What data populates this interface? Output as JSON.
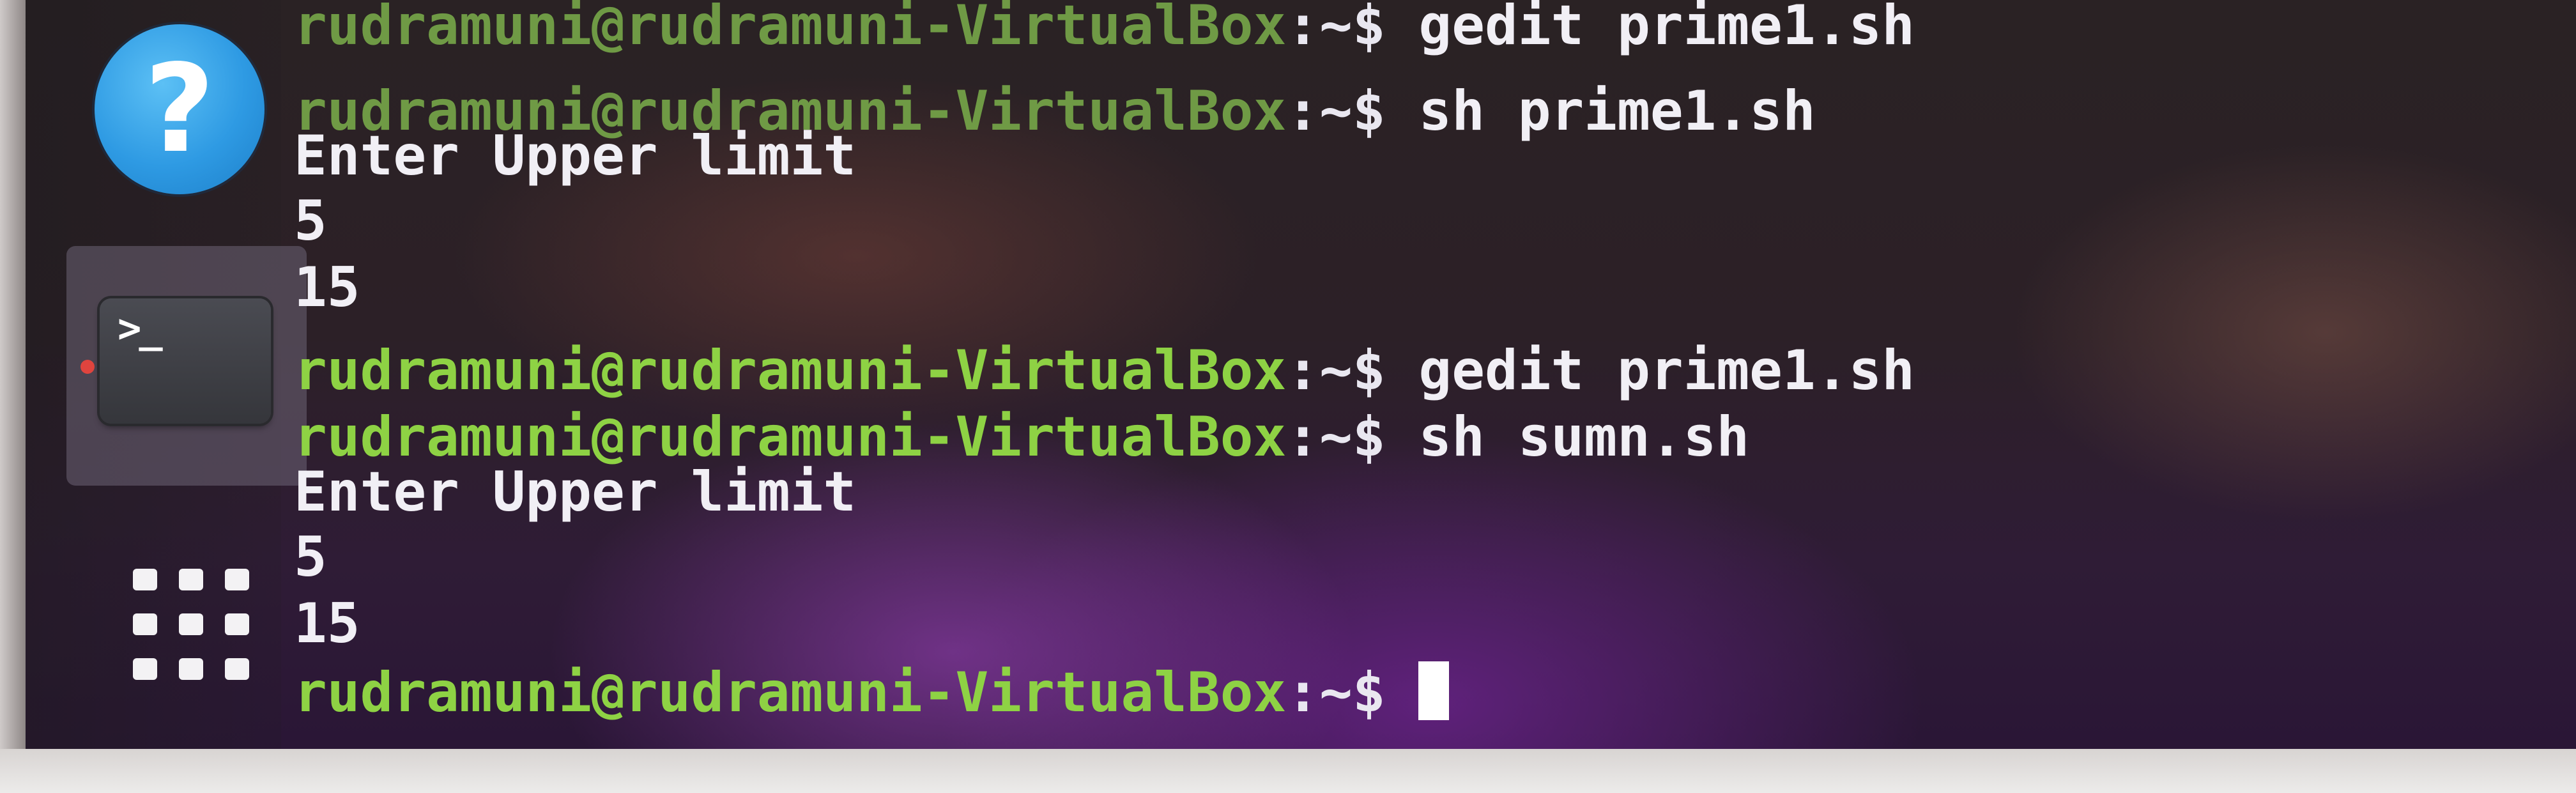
{
  "dock": {
    "help_icon": "help-question-icon",
    "help_glyph": "?",
    "terminal_icon": "terminal-icon",
    "terminal_glyph": ">_",
    "apps_icon": "show-applications-grid-icon"
  },
  "terminal": {
    "lines": [
      {
        "type": "prompt",
        "user_host": "rudramuni@rudramuni-VirtualBox",
        "path": ":~$",
        "command": " gedit prime1.sh"
      },
      {
        "type": "prompt",
        "user_host": "rudramuni@rudramuni-VirtualBox",
        "path": ":~$",
        "command": " sh prime1.sh"
      },
      {
        "type": "output",
        "text": "Enter Upper limit"
      },
      {
        "type": "output",
        "text": "5"
      },
      {
        "type": "output",
        "text": "15"
      },
      {
        "type": "prompt",
        "user_host": "rudramuni@rudramuni-VirtualBox",
        "path": ":~$",
        "command": " gedit prime1.sh"
      },
      {
        "type": "prompt",
        "user_host": "rudramuni@rudramuni-VirtualBox",
        "path": ":~$",
        "command": " sh sumn.sh"
      },
      {
        "type": "output",
        "text": "Enter Upper limit"
      },
      {
        "type": "output",
        "text": "5"
      },
      {
        "type": "output",
        "text": "15"
      },
      {
        "type": "prompt",
        "user_host": "rudramuni@rudramuni-VirtualBox",
        "path": ":~$",
        "command": " "
      }
    ]
  },
  "colors": {
    "prompt_green": "#8ed244",
    "text_white": "#f1eff5",
    "dock_help_blue": "#2e9ae3",
    "running_indicator": "#e0443e"
  }
}
